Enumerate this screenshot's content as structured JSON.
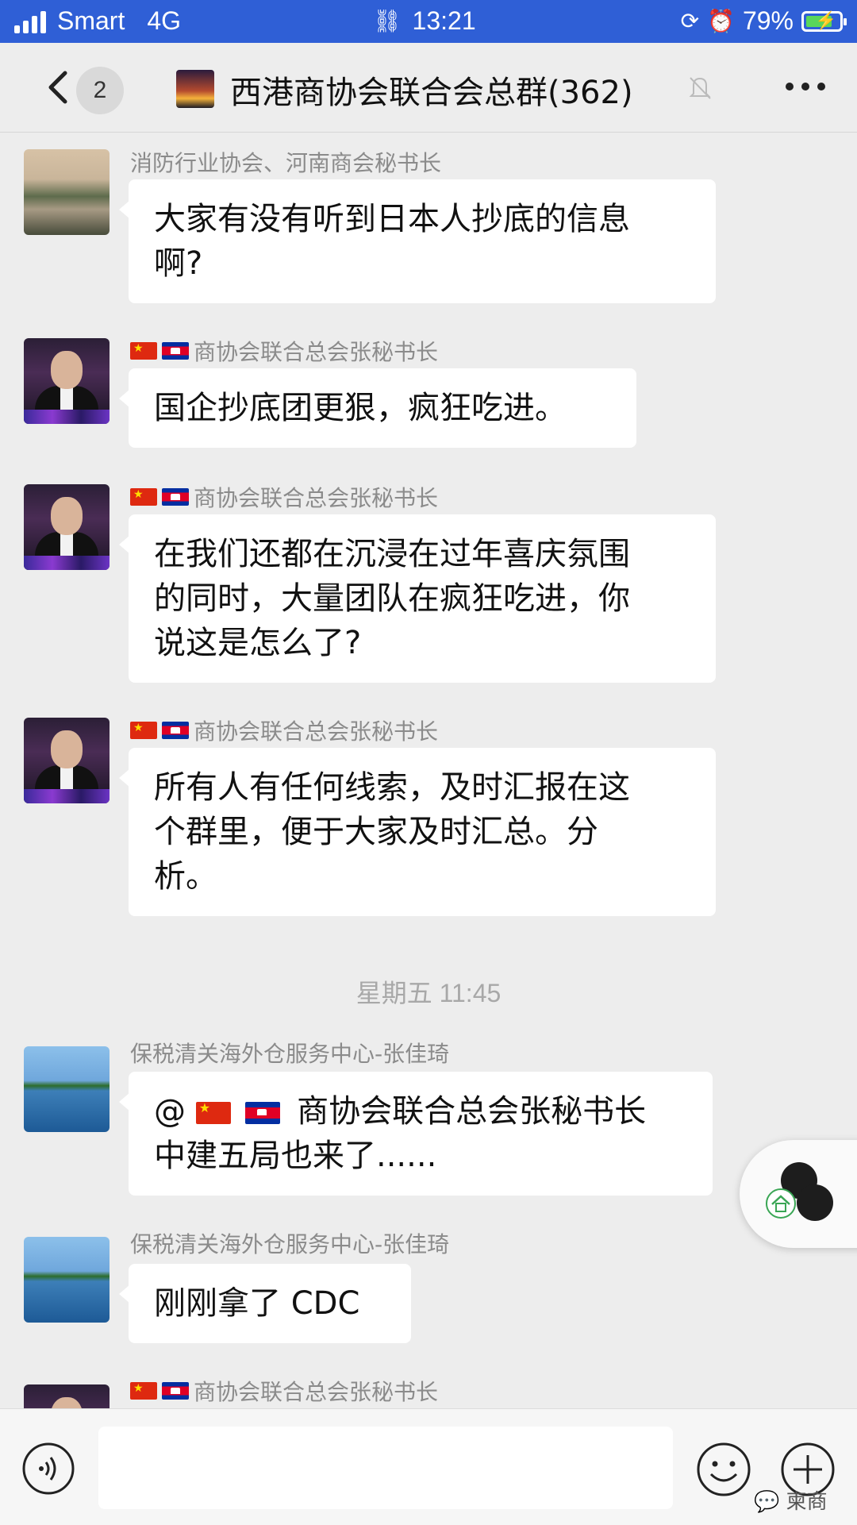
{
  "status_bar": {
    "carrier": "Smart",
    "network": "4G",
    "time": "13:21",
    "battery": "79%",
    "battery_level": 0.79
  },
  "header": {
    "back_badge": "2",
    "title": "西港商协会联合会总群(362)"
  },
  "messages": [
    {
      "sender": "消防行业协会、河南商会秘书长",
      "lines": [
        "大家有没有听到日本人抄底的信息",
        "啊?"
      ]
    },
    {
      "sender": "商协会联合总会张秘书长",
      "lines": [
        "国企抄底团更狠，疯狂吃进。"
      ]
    },
    {
      "sender": "商协会联合总会张秘书长",
      "lines": [
        "在我们还都在沉浸在过年喜庆氛围",
        "的同时，大量团队在疯狂吃进，你",
        "说这是怎么了?"
      ]
    },
    {
      "sender": "商协会联合总会张秘书长",
      "lines": [
        "所有人有任何线索，及时汇报在这",
        "个群里，便于大家及时汇总。分",
        "析。"
      ]
    },
    {
      "sender": "保税清关海外仓服务中心-张佳琦",
      "lines": [
        "商协会联合总会张秘书长",
        "中建五局也来了......"
      ],
      "mention_prefix": "@"
    },
    {
      "sender": "保税清关海外仓服务中心-张佳琦",
      "lines": [
        "刚刚拿了 CDC"
      ]
    },
    {
      "sender": "商协会联合总会张秘书长"
    }
  ],
  "time_divider": "星期五 11:45",
  "input": {
    "placeholder": ""
  },
  "watermark": "柬商",
  "colors": {
    "status_bar": "#2f5fd6",
    "chat_bg": "#ededed",
    "bubble": "#ffffff",
    "sender_name": "#8b8b8b"
  }
}
